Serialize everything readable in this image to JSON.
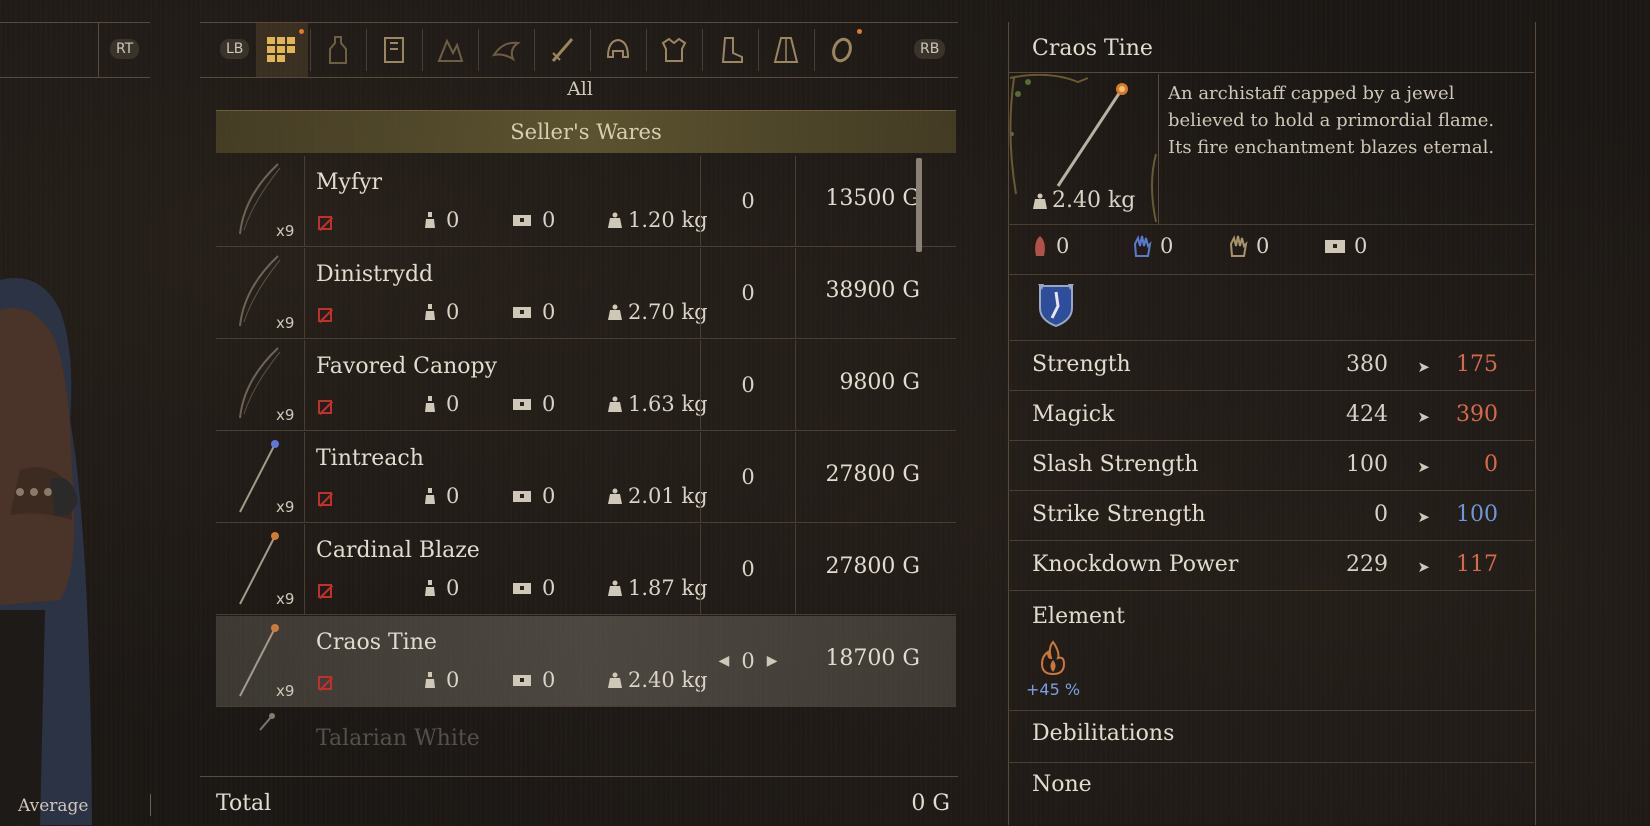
{
  "left": {
    "trigger_label": "RT",
    "status_label": "Average"
  },
  "tabs": {
    "lb_label": "LB",
    "rb_label": "RB",
    "current_category": "All",
    "icons": [
      "all-grid-icon",
      "consumable-icon",
      "scroll-icon",
      "materials-icon",
      "bird-icon",
      "sword-icon",
      "helmet-icon",
      "armor-icon",
      "boot-icon",
      "cloak-icon",
      "ring-icon"
    ]
  },
  "shop": {
    "section_title": "Seller's Wares",
    "items": [
      {
        "name": "Myfyr",
        "count": "x9",
        "s1": "0",
        "s2": "0",
        "weight": "1.20 kg",
        "qty": "0",
        "price": "13500 G"
      },
      {
        "name": "Dinistrydd",
        "count": "x9",
        "s1": "0",
        "s2": "0",
        "weight": "2.70 kg",
        "qty": "0",
        "price": "38900 G"
      },
      {
        "name": "Favored Canopy",
        "count": "x9",
        "s1": "0",
        "s2": "0",
        "weight": "1.63 kg",
        "qty": "0",
        "price": "9800 G"
      },
      {
        "name": "Tintreach",
        "count": "x9",
        "s1": "0",
        "s2": "0",
        "weight": "2.01 kg",
        "qty": "0",
        "price": "27800 G"
      },
      {
        "name": "Cardinal Blaze",
        "count": "x9",
        "s1": "0",
        "s2": "0",
        "weight": "1.87 kg",
        "qty": "0",
        "price": "27800 G"
      },
      {
        "name": "Craos Tine",
        "count": "x9",
        "s1": "0",
        "s2": "0",
        "weight": "2.40 kg",
        "qty": "0",
        "price": "18700 G"
      }
    ],
    "partial_item": "Talarian White",
    "total_label": "Total",
    "total_value": "0 G"
  },
  "detail": {
    "title": "Craos Tine",
    "weight": "2.40 kg",
    "description": "An archistaff capped by a jewel believed to hold a primordial flame. Its fire enchantment blazes eternal.",
    "resistances": [
      "0",
      "0",
      "0",
      "0"
    ],
    "stats": [
      {
        "label": "Strength",
        "current": "380",
        "new": "175",
        "trend": "down"
      },
      {
        "label": "Magick",
        "current": "424",
        "new": "390",
        "trend": "down"
      },
      {
        "label": "Slash Strength",
        "current": "100",
        "new": "0",
        "trend": "down"
      },
      {
        "label": "Strike Strength",
        "current": "0",
        "new": "100",
        "trend": "up"
      },
      {
        "label": "Knockdown Power",
        "current": "229",
        "new": "117",
        "trend": "down"
      }
    ],
    "element_label": "Element",
    "element_value": "+45 %",
    "debilitations_label": "Debilitations",
    "debilitations_value": "None"
  },
  "colors": {
    "negative": "#d46a4c",
    "positive": "#6f96d6"
  }
}
